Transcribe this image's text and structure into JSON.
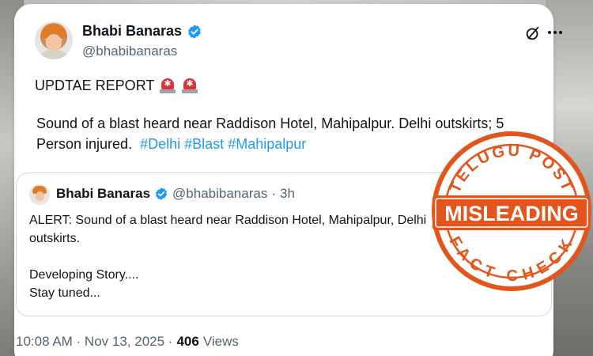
{
  "post": {
    "display_name": "Bhabi Banaras",
    "handle": "@bhabibanaras",
    "text_line1": "UPDTAE REPORT",
    "text_line2_prefix": "Sound of a blast heard near Raddison Hotel, Mahipalpur. Delhi outskirts; 5 Person injured.",
    "hashtags": [
      "#Delhi",
      "#Blast",
      "#Mahipalpur"
    ],
    "timestamp": "10:08 AM · Nov 13, 2025 ·",
    "views_count": "406",
    "views_label": "Views"
  },
  "quoted": {
    "display_name": "Bhabi Banaras",
    "handle": "@bhabibanaras",
    "separator": "·",
    "age": "3h",
    "body": "ALERT: Sound of a blast heard near Raddison Hotel, Mahipalpur, Delhi\noutskirts.\n\nDeveloping Story....\nStay tuned..."
  },
  "stamp": {
    "top_text": "TELUGU POST",
    "center_text": "MISLEADING",
    "bottom_text": "FACT CHECK",
    "color": "#e2561d"
  },
  "icons": {
    "verified": "verified-badge-icon",
    "grok": "grok-icon",
    "more": "more-options-icon",
    "siren": "police-siren-icon"
  },
  "colors": {
    "link": "#1d9bf0",
    "text": "#0f1419",
    "muted": "#536471"
  }
}
